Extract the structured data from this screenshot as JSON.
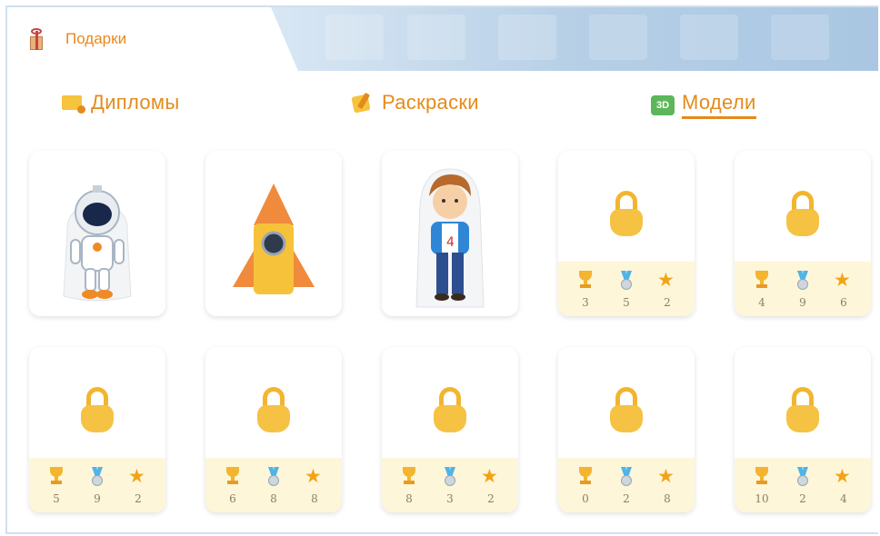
{
  "header": {
    "title": "Подарки"
  },
  "categories": [
    {
      "label": "Дипломы",
      "icon": "diploma-icon",
      "active": false
    },
    {
      "label": "Раскраски",
      "icon": "coloring-icon",
      "active": false
    },
    {
      "label": "Модели",
      "icon": "model-3d-icon",
      "badge": "3D",
      "active": true
    }
  ],
  "colors": {
    "accent": "#e48b1c",
    "lock": "#f6c244",
    "stats_bg": "#fdf6d9"
  },
  "models": [
    {
      "type": "unlocked",
      "name": "astronaut"
    },
    {
      "type": "unlocked",
      "name": "rocket"
    },
    {
      "type": "unlocked",
      "name": "boy"
    },
    {
      "type": "locked",
      "trophies": "3",
      "medals": "5",
      "stars": "2"
    },
    {
      "type": "locked",
      "trophies": "4",
      "medals": "9",
      "stars": "6"
    },
    {
      "type": "locked",
      "trophies": "5",
      "medals": "9",
      "stars": "2"
    },
    {
      "type": "locked",
      "trophies": "6",
      "medals": "8",
      "stars": "8"
    },
    {
      "type": "locked",
      "trophies": "8",
      "medals": "3",
      "stars": "2"
    },
    {
      "type": "locked",
      "trophies": "0",
      "medals": "2",
      "stars": "8"
    },
    {
      "type": "locked",
      "trophies": "10",
      "medals": "2",
      "stars": "4"
    }
  ]
}
